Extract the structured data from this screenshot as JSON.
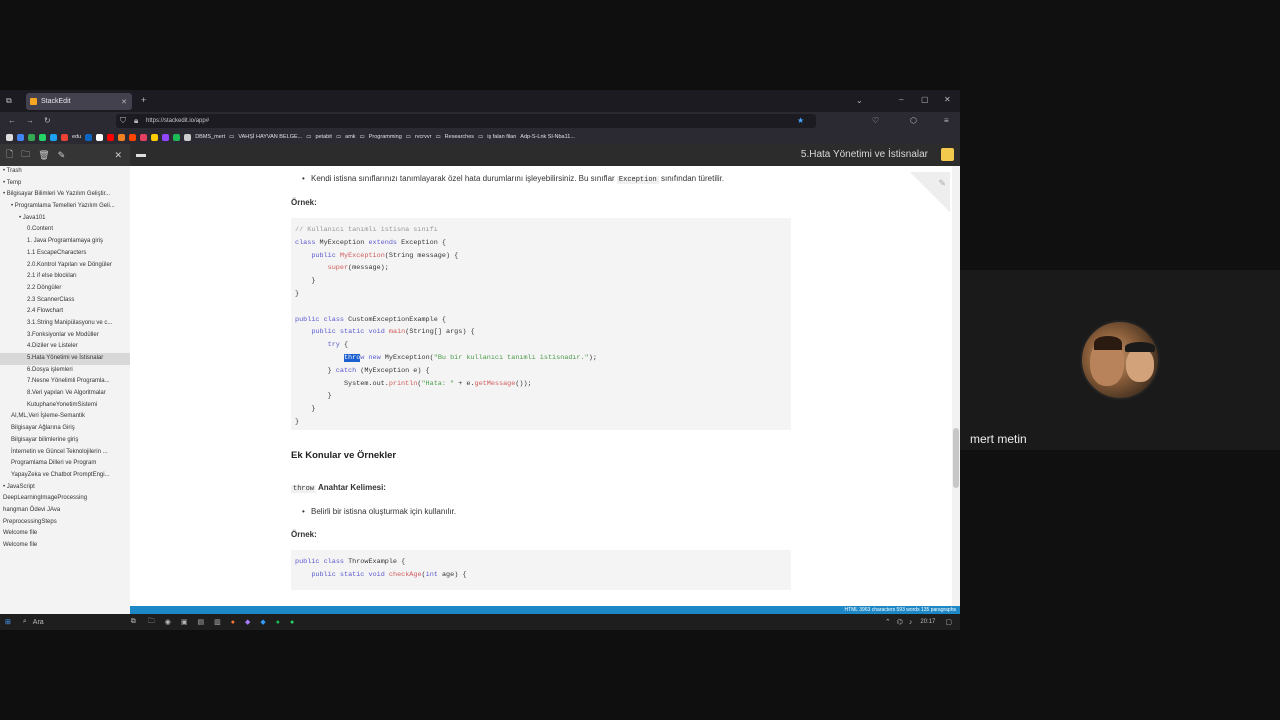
{
  "browser": {
    "tab_title": "StackEdit",
    "url": "https://stackedit.io/app#",
    "bookmarks": [
      "edu",
      "DBMS_mert",
      "VAHŞİ HAYVAN BELGE...",
      "petabit",
      "amk",
      "Programming",
      "rvcrvvr",
      "Researches",
      "iş falan filan",
      "Adp-S-Lnk Sl-Nba11..."
    ]
  },
  "editor": {
    "file_title": "5.Hata Yönetimi ve İstisnalar"
  },
  "sidebar": {
    "items": [
      {
        "label": "• Trash",
        "indent": 0
      },
      {
        "label": "• Temp",
        "indent": 0
      },
      {
        "label": "• Bilgisayar Bilimleri Ve Yazılım Geliştir...",
        "indent": 0
      },
      {
        "label": "• Programlama Temelleri Yazılım Geli...",
        "indent": 1
      },
      {
        "label": "• Java101",
        "indent": 2
      },
      {
        "label": "0.Content",
        "indent": 3
      },
      {
        "label": "1. Java Programlamaya giriş",
        "indent": 3
      },
      {
        "label": "1.1 EscapeCharacters",
        "indent": 3
      },
      {
        "label": "2.0.Kontrol Yapıları ve Döngüler",
        "indent": 3
      },
      {
        "label": "2.1 if else blockları",
        "indent": 3
      },
      {
        "label": "2.2 Döngüler",
        "indent": 3
      },
      {
        "label": "2.3 ScannerClass",
        "indent": 3
      },
      {
        "label": "2.4 Flowchart",
        "indent": 3
      },
      {
        "label": "3.1.String Manipülasyonu ve c...",
        "indent": 3
      },
      {
        "label": "3.Fonksiyonlar ve Modüller",
        "indent": 3
      },
      {
        "label": "4.Diziler ve Listeler",
        "indent": 3
      },
      {
        "label": "5.Hata Yönetimi ve İstisnalar",
        "indent": 3,
        "active": true
      },
      {
        "label": "6.Dosya işlemleri",
        "indent": 3
      },
      {
        "label": "7.Nesne Yönelimli Programla...",
        "indent": 3
      },
      {
        "label": "8.Veri yapıları Ve Algoritmalar",
        "indent": 3
      },
      {
        "label": "KutuphaneYonetimSistemi",
        "indent": 3
      },
      {
        "label": "AI,ML,Veri İşleme-Semantik",
        "indent": 1
      },
      {
        "label": "Bilgisayar Ağlarına Giriş",
        "indent": 1
      },
      {
        "label": "Bilgisayar bilimlerine giriş",
        "indent": 1
      },
      {
        "label": "İnternetin ve Güncel Teknolojilerin ...",
        "indent": 1
      },
      {
        "label": "Programlama Dilleri ve Program",
        "indent": 1
      },
      {
        "label": "YapayZeka ve Chatbot PromptEngi...",
        "indent": 1
      },
      {
        "label": "• JavaScript",
        "indent": 0
      },
      {
        "label": "DeepLearningImageProcessing",
        "indent": 0
      },
      {
        "label": "hangman Ödevi JAva",
        "indent": 0
      },
      {
        "label": "PreprocessingSteps",
        "indent": 0
      },
      {
        "label": "Welcome file",
        "indent": 0
      },
      {
        "label": "Welcome file",
        "indent": 0
      }
    ]
  },
  "doc": {
    "bullet1": "Kendi istisna sınıflarınızı tanımlayarak özel hata durumlarını işleyebilirsiniz. Bu sınıflar",
    "bullet1_code": "Exception",
    "bullet1_tail": "sınıfından türetilir.",
    "ornek1": "Örnek:",
    "heading": "Ek Konular ve Örnekler",
    "throw_code": "throw",
    "throw_label": "Anahtar Kelimesi:",
    "bullet2": "Belirli bir istisna oluşturmak için kullanılır.",
    "ornek2": "Örnek:"
  },
  "status": {
    "text": "HTML   3963 characters   593 words   135 paragraphs"
  },
  "taskbar": {
    "search": "Ara",
    "time": "20:17"
  },
  "participant": {
    "name": "mert metin"
  }
}
